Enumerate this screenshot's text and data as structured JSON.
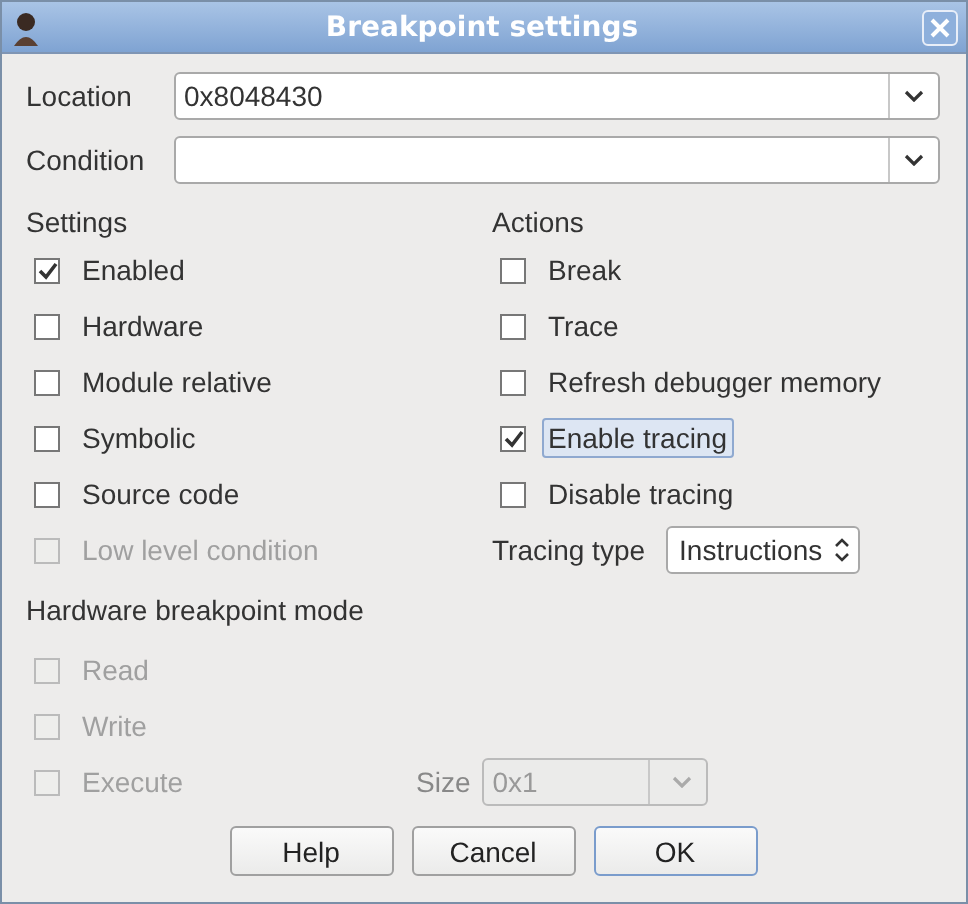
{
  "window": {
    "title": "Breakpoint settings"
  },
  "location": {
    "label": "Location",
    "value": "0x8048430"
  },
  "condition": {
    "label": "Condition"
  },
  "settings": {
    "title": "Settings",
    "items": [
      {
        "label": "Enabled",
        "checked": true,
        "disabled": false
      },
      {
        "label": "Hardware",
        "checked": false,
        "disabled": false
      },
      {
        "label": "Module relative",
        "checked": false,
        "disabled": false
      },
      {
        "label": "Symbolic",
        "checked": false,
        "disabled": false
      },
      {
        "label": "Source code",
        "checked": false,
        "disabled": false
      },
      {
        "label": "Low level condition",
        "checked": false,
        "disabled": true
      }
    ]
  },
  "actions": {
    "title": "Actions",
    "items": [
      {
        "label": "Break",
        "checked": false,
        "focused": false
      },
      {
        "label": "Trace",
        "checked": false,
        "focused": false
      },
      {
        "label": "Refresh debugger memory",
        "checked": false,
        "focused": false
      },
      {
        "label": "Enable tracing",
        "checked": true,
        "focused": true
      },
      {
        "label": "Disable tracing",
        "checked": false,
        "focused": false
      }
    ]
  },
  "tracing_type": {
    "label": "Tracing type",
    "value": "Instructions"
  },
  "hardware_mode": {
    "title": "Hardware breakpoint mode",
    "items": [
      {
        "label": "Read",
        "checked": false,
        "disabled": true
      },
      {
        "label": "Write",
        "checked": false,
        "disabled": true
      },
      {
        "label": "Execute",
        "checked": false,
        "disabled": true
      }
    ]
  },
  "size": {
    "label": "Size",
    "value": "0x1",
    "disabled": true
  },
  "buttons": [
    {
      "label": "Help",
      "default": false
    },
    {
      "label": "Cancel",
      "default": false
    },
    {
      "label": "OK",
      "default": true
    }
  ]
}
